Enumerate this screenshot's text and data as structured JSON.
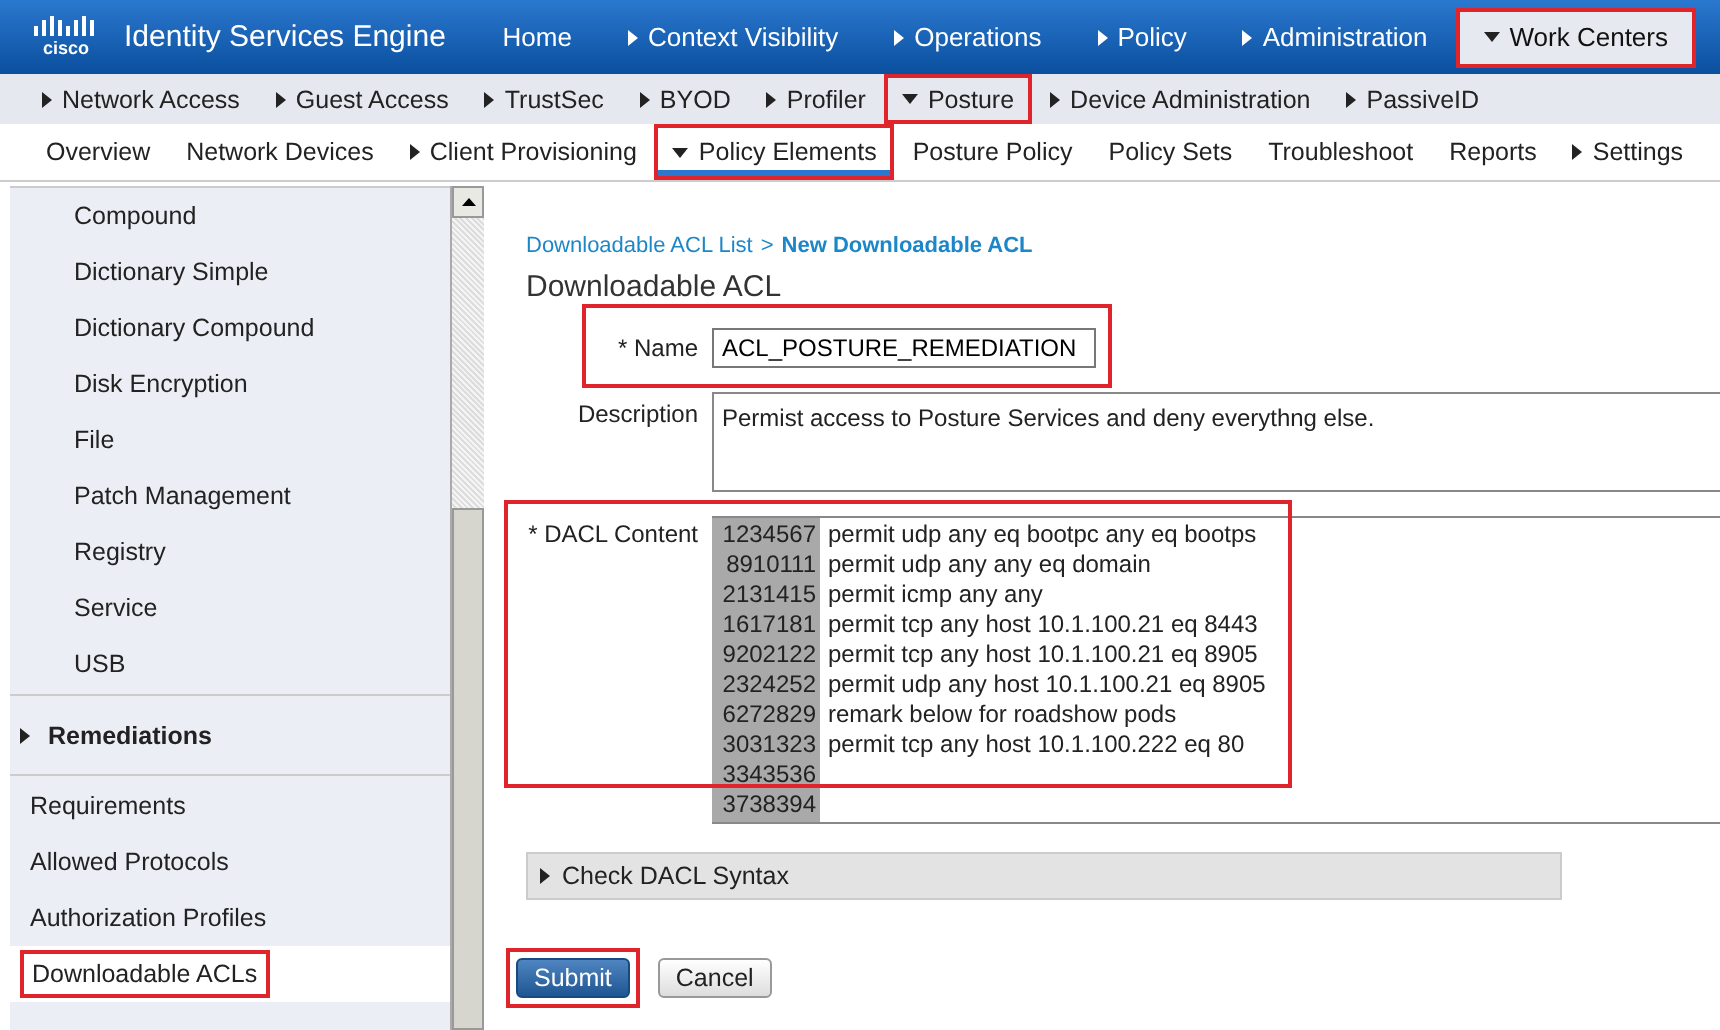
{
  "header": {
    "logo": "cisco",
    "title": "Identity Services Engine"
  },
  "main_nav": [
    {
      "label": "Home",
      "menu": false,
      "selected": false,
      "highlighted": false
    },
    {
      "label": "Context Visibility",
      "menu": true,
      "selected": false,
      "highlighted": false
    },
    {
      "label": "Operations",
      "menu": true,
      "selected": false,
      "highlighted": false
    },
    {
      "label": "Policy",
      "menu": true,
      "selected": false,
      "highlighted": false
    },
    {
      "label": "Administration",
      "menu": true,
      "selected": false,
      "highlighted": false
    },
    {
      "label": "Work Centers",
      "menu": true,
      "selected": true,
      "highlighted": true
    }
  ],
  "sub_nav": [
    {
      "label": "Network Access",
      "menu": true,
      "selected": false,
      "highlighted": false
    },
    {
      "label": "Guest Access",
      "menu": true,
      "selected": false,
      "highlighted": false
    },
    {
      "label": "TrustSec",
      "menu": true,
      "selected": false,
      "highlighted": false
    },
    {
      "label": "BYOD",
      "menu": true,
      "selected": false,
      "highlighted": false
    },
    {
      "label": "Profiler",
      "menu": true,
      "selected": false,
      "highlighted": false
    },
    {
      "label": "Posture",
      "menu": true,
      "selected": true,
      "highlighted": true
    },
    {
      "label": "Device Administration",
      "menu": true,
      "selected": false,
      "highlighted": false
    },
    {
      "label": "PassiveID",
      "menu": true,
      "selected": false,
      "highlighted": false
    }
  ],
  "tabs": [
    {
      "label": "Overview",
      "menu": false,
      "selected": false,
      "highlighted": false
    },
    {
      "label": "Network Devices",
      "menu": false,
      "selected": false,
      "highlighted": false
    },
    {
      "label": "Client Provisioning",
      "menu": true,
      "selected": false,
      "highlighted": false
    },
    {
      "label": "Policy Elements",
      "menu": true,
      "selected": true,
      "highlighted": true
    },
    {
      "label": "Posture Policy",
      "menu": false,
      "selected": false,
      "highlighted": false
    },
    {
      "label": "Policy Sets",
      "menu": false,
      "selected": false,
      "highlighted": false
    },
    {
      "label": "Troubleshoot",
      "menu": false,
      "selected": false,
      "highlighted": false
    },
    {
      "label": "Reports",
      "menu": false,
      "selected": false,
      "highlighted": false
    },
    {
      "label": "Settings",
      "menu": true,
      "selected": false,
      "highlighted": false
    }
  ],
  "sidebar": {
    "items": [
      {
        "kind": "child",
        "label": "Compound",
        "selected": false,
        "highlighted": false
      },
      {
        "kind": "child",
        "label": "Dictionary Simple",
        "selected": false,
        "highlighted": false
      },
      {
        "kind": "child",
        "label": "Dictionary Compound",
        "selected": false,
        "highlighted": false
      },
      {
        "kind": "child",
        "label": "Disk Encryption",
        "selected": false,
        "highlighted": false
      },
      {
        "kind": "child",
        "label": "File",
        "selected": false,
        "highlighted": false
      },
      {
        "kind": "child",
        "label": "Patch Management",
        "selected": false,
        "highlighted": false
      },
      {
        "kind": "child",
        "label": "Registry",
        "selected": false,
        "highlighted": false
      },
      {
        "kind": "child",
        "label": "Service",
        "selected": false,
        "highlighted": false
      },
      {
        "kind": "child",
        "label": "USB",
        "selected": false,
        "highlighted": false
      },
      {
        "kind": "section",
        "label": "Remediations",
        "selected": false,
        "highlighted": false
      },
      {
        "kind": "item",
        "label": "Requirements",
        "selected": false,
        "highlighted": false
      },
      {
        "kind": "item",
        "label": "Allowed Protocols",
        "selected": false,
        "highlighted": false
      },
      {
        "kind": "item",
        "label": "Authorization Profiles",
        "selected": false,
        "highlighted": false
      },
      {
        "kind": "item",
        "label": "Downloadable ACLs",
        "selected": true,
        "highlighted": true
      }
    ]
  },
  "breadcrumb": {
    "link": "Downloadable ACL List",
    "separator": ">",
    "current": "New Downloadable ACL"
  },
  "form": {
    "title": "Downloadable ACL",
    "fields": [
      {
        "kind": "input",
        "label": "* Name",
        "value": "ACL_POSTURE_REMEDIATION",
        "highlighted": true
      },
      {
        "kind": "textarea",
        "label": "Description",
        "value": "Permist access to Posture Services and deny everythng else.",
        "highlighted": false
      },
      {
        "kind": "code",
        "label": "* DACL Content",
        "highlighted": true,
        "lines": [
          {
            "number": "1234567",
            "text": "permit udp any eq bootpc any eq bootps"
          },
          {
            "number": "8910111",
            "text": "permit udp any any eq domain"
          },
          {
            "number": "2131415",
            "text": "permit icmp any any"
          },
          {
            "number": "1617181",
            "text": "permit tcp any host 10.1.100.21 eq 8443"
          },
          {
            "number": "9202122",
            "text": "permit tcp any host 10.1.100.21 eq 8905"
          },
          {
            "number": "2324252",
            "text": "permit udp any host 10.1.100.21 eq 8905"
          },
          {
            "number": "6272829",
            "text": "remark below for roadshow pods"
          },
          {
            "number": "3031323",
            "text": "permit tcp any host 10.1.100.222 eq 80"
          },
          {
            "number": "3343536"
          },
          {
            "number": "3738394"
          }
        ]
      }
    ],
    "syntax_panel": {
      "label": "Check DACL Syntax",
      "expanded": false
    },
    "buttons": [
      {
        "kind": "primary",
        "label": "Submit",
        "highlighted": true
      },
      {
        "kind": "secondary",
        "label": "Cancel",
        "highlighted": false
      }
    ]
  }
}
